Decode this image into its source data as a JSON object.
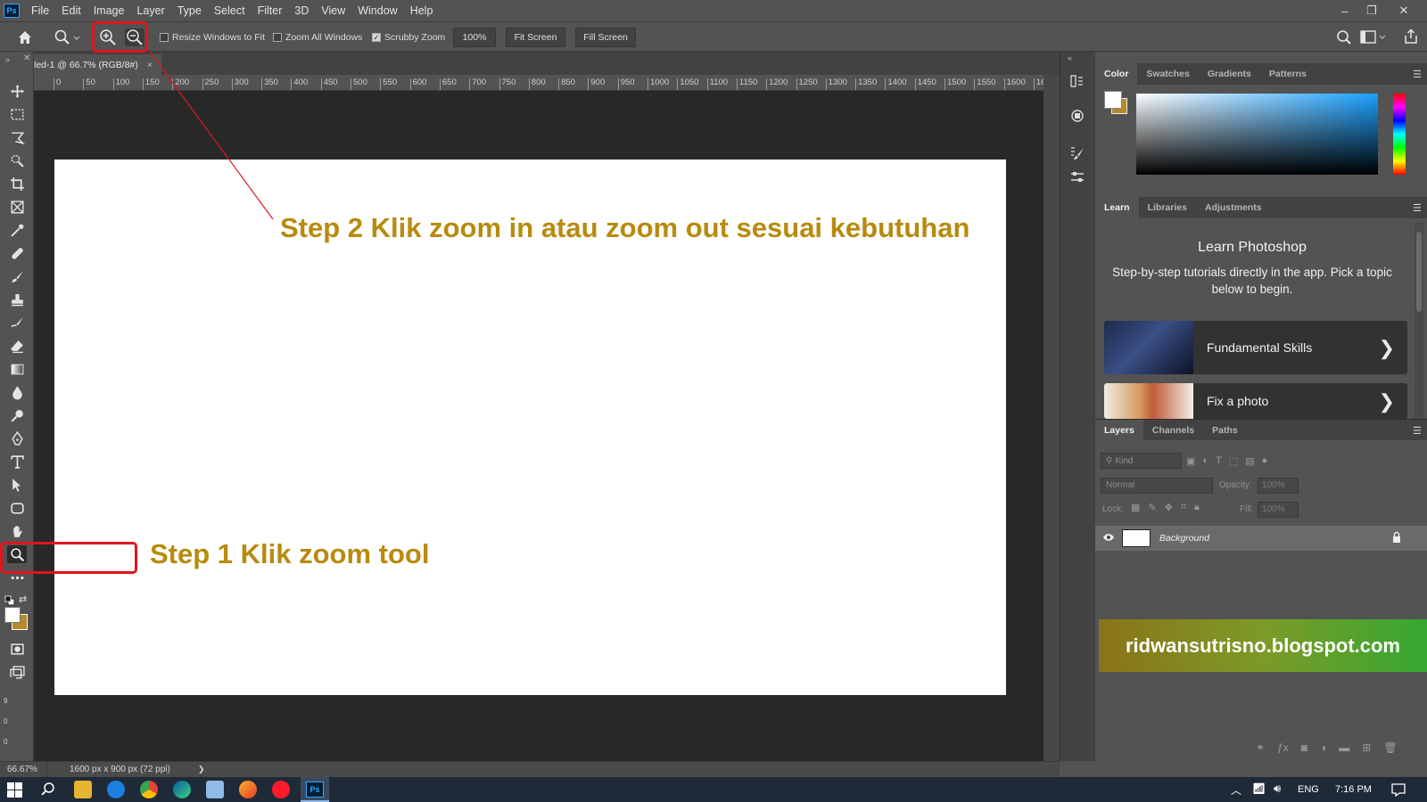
{
  "app": {
    "logo": "Ps"
  },
  "menubar": {
    "items": [
      "File",
      "Edit",
      "Image",
      "Layer",
      "Type",
      "Select",
      "Filter",
      "3D",
      "View",
      "Window",
      "Help"
    ]
  },
  "window_controls": {
    "minimize": "–",
    "restore": "❐",
    "close": "✕"
  },
  "options": {
    "resize_windows": "Resize Windows to Fit",
    "zoom_all": "Zoom All Windows",
    "scrubby": "Scrubby Zoom",
    "scrubby_check": "✓",
    "zoom_value": "100%",
    "fit_screen": "Fit Screen",
    "fill_screen": "Fill Screen"
  },
  "document": {
    "tab_title": "led-1 @ 66.7% (RGB/8#)",
    "tab_close": "×"
  },
  "ruler": {
    "ticks": [
      "0",
      "50",
      "100",
      "150",
      "200",
      "250",
      "300",
      "350",
      "400",
      "450",
      "500",
      "550",
      "600",
      "650",
      "700",
      "750",
      "800",
      "850",
      "900",
      "950",
      "1000",
      "1050",
      "1100",
      "1150",
      "1200",
      "1250",
      "1300",
      "1350",
      "1400",
      "1450",
      "1500",
      "1550",
      "1600",
      "16"
    ]
  },
  "ruler_v": {
    "ticks": [
      "9",
      "0",
      "0"
    ]
  },
  "status": {
    "zoom": "66.67%",
    "doc_size": "1600 px x 900 px (72 ppi)",
    "arrow": "❯"
  },
  "color_panel": {
    "tabs": [
      "Color",
      "Swatches",
      "Gradients",
      "Patterns"
    ]
  },
  "learn_panel": {
    "tabs": [
      "Learn",
      "Libraries",
      "Adjustments"
    ],
    "title": "Learn Photoshop",
    "description": "Step-by-step tutorials directly in the app. Pick a topic below to begin.",
    "cards": [
      {
        "label": "Fundamental Skills"
      },
      {
        "label": "Fix a photo"
      }
    ],
    "chevron": "❯"
  },
  "layers_panel": {
    "tabs": [
      "Layers",
      "Channels",
      "Paths"
    ],
    "kind_placeholder": "Kind",
    "blend_mode": "Normal",
    "opacity_label": "Opacity:",
    "opacity_value": "100%",
    "lock_label": "Lock:",
    "fill_label": "Fill:",
    "fill_value": "100%",
    "layers": [
      {
        "name": "Background"
      }
    ]
  },
  "annotations": {
    "step1": "Step 1 Klik zoom tool",
    "step2": "Step 2 Klik zoom in atau zoom out sesuai kebutuhan",
    "watermark": "ridwansutrisno.blogspot.com",
    "color": "#b88a0e",
    "highlight_color": "#e0141e"
  },
  "taskbar": {
    "language": "ENG",
    "time": "7:16 PM"
  }
}
